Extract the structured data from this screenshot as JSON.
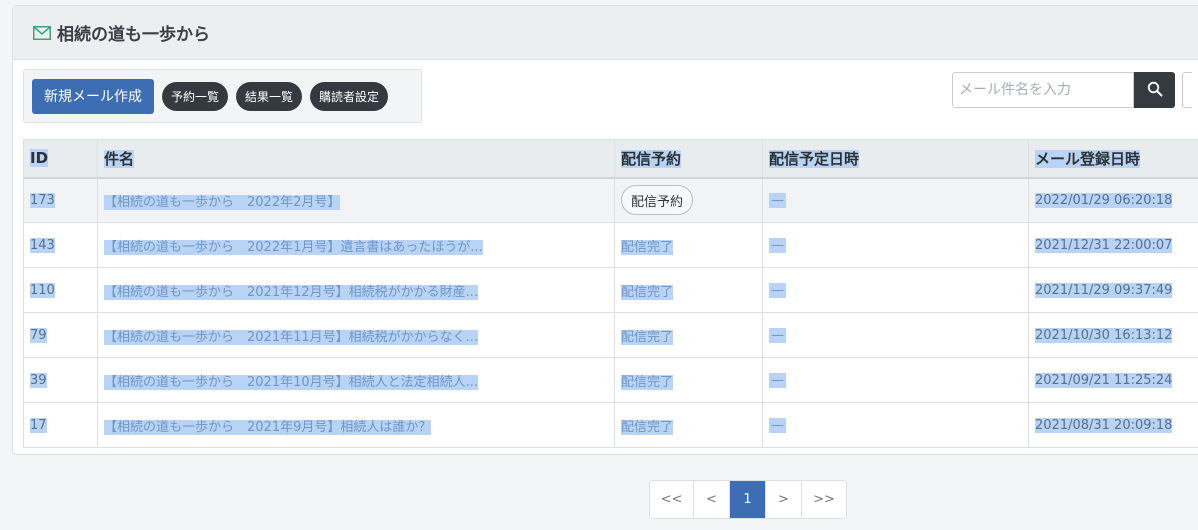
{
  "header": {
    "title": "相続の道も一歩から",
    "icon": "mail-icon",
    "icon_color": "#3aa37a"
  },
  "toolbar": {
    "new_mail": "新規メール作成",
    "schedule_list": "予約一覧",
    "result_list": "結果一覧",
    "subscriber_settings": "購読者設定"
  },
  "search": {
    "placeholder": "メール件名を入力",
    "icon": "search-icon"
  },
  "table": {
    "headers": [
      "ID",
      "件名",
      "配信予約",
      "配信予定日時",
      "メール登録日時"
    ],
    "rows": [
      {
        "id": "173",
        "subject": "【相続の道も一歩から　2022年2月号】",
        "status": "配信予約",
        "scheduled": "—",
        "registered": "2022/01/29 06:20:18"
      },
      {
        "id": "143",
        "subject": "【相続の道も一歩から　2022年1月号】遺言書はあったほうが...",
        "status": "配信完了",
        "scheduled": "—",
        "registered": "2021/12/31 22:00:07"
      },
      {
        "id": "110",
        "subject": "【相続の道も一歩から　2021年12月号】相続税がかかる財産...",
        "status": "配信完了",
        "scheduled": "—",
        "registered": "2021/11/29 09:37:49"
      },
      {
        "id": "79",
        "subject": "【相続の道も一歩から　2021年11月号】相続税がかからなく...",
        "status": "配信完了",
        "scheduled": "—",
        "registered": "2021/10/30 16:13:12"
      },
      {
        "id": "39",
        "subject": "【相続の道も一歩から　2021年10月号】相続人と法定相続人...",
        "status": "配信完了",
        "scheduled": "—",
        "registered": "2021/09/21 11:25:24"
      },
      {
        "id": "17",
        "subject": "【相続の道も一歩から　2021年9月号】相続人は誰か？",
        "status": "配信完了",
        "scheduled": "—",
        "registered": "2021/08/31 20:09:18"
      }
    ]
  },
  "pagination": {
    "first": "<<",
    "prev": "<",
    "current": "1",
    "next": ">",
    "last": ">>"
  }
}
